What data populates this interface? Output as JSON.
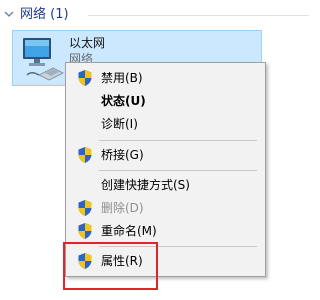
{
  "group": {
    "title": "网络 (1)"
  },
  "network_item": {
    "name": "以太网",
    "subtitle": "网络",
    "icon": "network-adapter-icon"
  },
  "context_menu": {
    "items": [
      {
        "label": "禁用(B)",
        "shield": true
      },
      {
        "label": "状态(U)",
        "bold": true
      },
      {
        "label": "诊断(I)"
      },
      {
        "label": "桥接(G)",
        "shield": true
      },
      {
        "label": "创建快捷方式(S)"
      },
      {
        "label": "删除(D)",
        "shield": true,
        "disabled": true
      },
      {
        "label": "重命名(M)",
        "shield": true
      },
      {
        "label": "属性(R)",
        "shield": true,
        "highlighted": true
      }
    ]
  },
  "colors": {
    "accent": "#1e3a8a",
    "selection_bg": "#cce8ff",
    "selection_border": "#99d1ff",
    "menu_bg": "#f2f2f2",
    "highlight_box": "#e0242a"
  }
}
